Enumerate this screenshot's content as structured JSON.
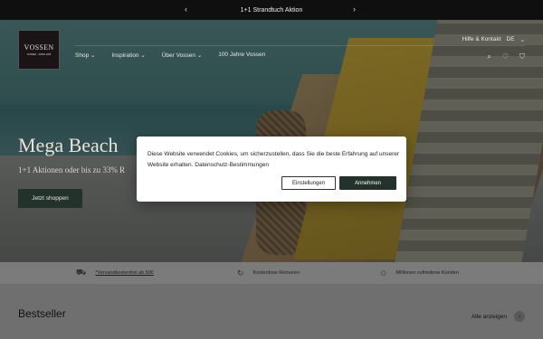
{
  "announcement": {
    "text": "1+1 Strandtuch Aktion",
    "prev": "‹",
    "next": "›"
  },
  "logo": {
    "brand": "VOSSEN",
    "tagline": "VOSSEN · SINCE 1925"
  },
  "nav": {
    "items": [
      "Shop",
      "Inspiration",
      "Über Vossen",
      "100 Jahre Vossen"
    ],
    "chevron": "⌄"
  },
  "topright": {
    "help": "Hilfe & Kontakt",
    "language": "DE",
    "chevron": "⌄"
  },
  "icons": {
    "search": "⌕",
    "account": "♡",
    "cart": "⛉"
  },
  "hero": {
    "headline": "Mega Beach",
    "subline": "1+1 Aktionen oder bis zu 33% R",
    "cta": "Jetzt shoppen"
  },
  "usp": [
    {
      "icon": "truck-icon",
      "glyph": "⛟",
      "text": "*Versandkostenfrei ab 50€"
    },
    {
      "icon": "return-icon",
      "glyph": "↻",
      "text": "Kostenlose Retouren"
    },
    {
      "icon": "star-icon",
      "glyph": "✩",
      "text": "Millionen zufriedene Kunden"
    }
  ],
  "bestseller": {
    "title": "Bestseller",
    "all_label": "Alle anzeigen",
    "arrow": "›"
  },
  "cookie": {
    "message": "Diese Website verwendet Cookies, um sicherzustellen, dass Sie die beste Erfahrung auf unserer Website erhalten.",
    "link": "Datenschutz-Bestimmungen",
    "settings": "Einstellungen",
    "accept": "Annehmen"
  },
  "colors": {
    "accent": "#23332b",
    "announcement_bg": "#0f0f0f"
  }
}
